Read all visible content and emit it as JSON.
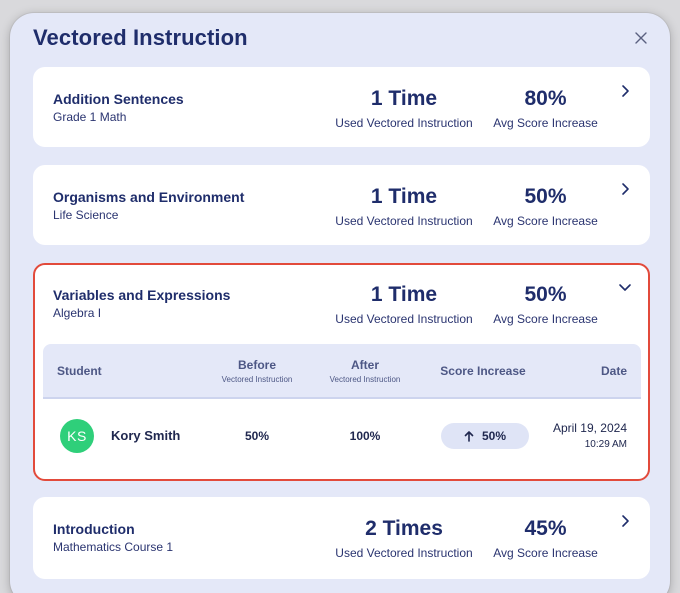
{
  "modal": {
    "title": "Vectored Instruction"
  },
  "cards": [
    {
      "name": "Addition Sentences",
      "subject": "Grade 1 Math",
      "times": "1 Time",
      "times_label": "Used Vectored Instruction",
      "avg": "80%",
      "avg_label": "Avg Score Increase"
    },
    {
      "name": "Organisms and Environment",
      "subject": "Life Science",
      "times": "1 Time",
      "times_label": "Used Vectored Instruction",
      "avg": "50%",
      "avg_label": "Avg Score Increase"
    },
    {
      "name": "Variables and Expressions",
      "subject": "Algebra I",
      "times": "1 Time",
      "times_label": "Used Vectored Instruction",
      "avg": "50%",
      "avg_label": "Avg Score Increase"
    },
    {
      "name": "Introduction",
      "subject": "Mathematics Course 1",
      "times": "2 Times",
      "times_label": "Used Vectored Instruction",
      "avg": "45%",
      "avg_label": "Avg Score Increase"
    }
  ],
  "table": {
    "headers": {
      "student": "Student",
      "before": "Before",
      "before_sub": "Vectored Instruction",
      "after": "After",
      "after_sub": "Vectored Instruction",
      "score": "Score Increase",
      "date": "Date"
    },
    "rows": [
      {
        "initials": "KS",
        "student": "Kory Smith",
        "before": "50%",
        "after": "100%",
        "increase": "50%",
        "date": "April 19, 2024",
        "time": "10:29 AM"
      }
    ]
  },
  "colors": {
    "accent": "#1f2d6b",
    "highlight_border": "#e24a3b",
    "avatar": "#2fcf7a",
    "modal_bg": "#e4e8f8"
  },
  "icons": {
    "close": "close-icon",
    "collapsed": "chevron-right-icon",
    "expanded": "chevron-down-icon",
    "increase": "arrow-up-icon"
  }
}
